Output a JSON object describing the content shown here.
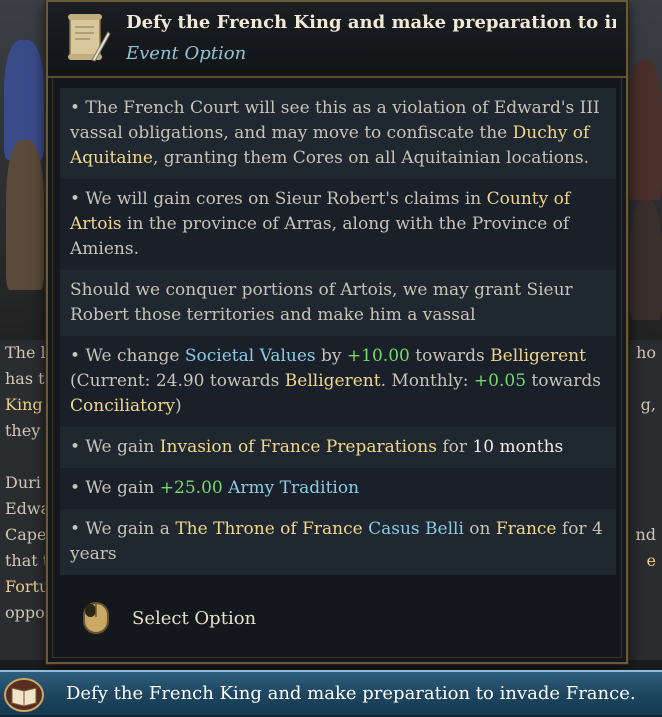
{
  "tooltip": {
    "title": "Defy the French King and make preparation to invade F ...",
    "subtitle": "Event Option",
    "effects": [
      [
        {
          "t": "• The French Court will see this as a violation of Edward's III vassal obligations, and may move to confiscate the ",
          "c": ""
        },
        {
          "t": "Duchy of Aquitaine",
          "c": "hl-y"
        },
        {
          "t": ", granting them Cores on all Aquitainian locations.",
          "c": ""
        }
      ],
      [
        {
          "t": "• We will gain cores on Sieur Robert's claims in ",
          "c": ""
        },
        {
          "t": "County of Artois",
          "c": "hl-y"
        },
        {
          "t": " in the province of Arras, along with the Province of Amiens.",
          "c": ""
        }
      ],
      [
        {
          "t": "Should we conquer portions of Artois, we may grant Sieur Robert those territories and make him a vassal",
          "c": ""
        }
      ],
      [
        {
          "t": "• We change ",
          "c": ""
        },
        {
          "t": "Societal Values",
          "c": "hl-b"
        },
        {
          "t": " by ",
          "c": ""
        },
        {
          "t": "+10.00",
          "c": "hl-g"
        },
        {
          "t": " towards ",
          "c": ""
        },
        {
          "t": "Belligerent",
          "c": "hl-y"
        },
        {
          "t": " (Current: 24.90 towards ",
          "c": ""
        },
        {
          "t": "Belligerent",
          "c": "hl-y"
        },
        {
          "t": ". Monthly: ",
          "c": ""
        },
        {
          "t": "+0.05",
          "c": "hl-g"
        },
        {
          "t": " towards ",
          "c": ""
        },
        {
          "t": "Conciliatory",
          "c": "hl-y"
        },
        {
          "t": ")",
          "c": ""
        }
      ],
      [
        {
          "t": "• We gain ",
          "c": ""
        },
        {
          "t": "Invasion of France Preparations",
          "c": "hl-y"
        },
        {
          "t": " for ",
          "c": ""
        },
        {
          "t": "10 months",
          "c": "hl-w"
        }
      ],
      [
        {
          "t": "• We gain ",
          "c": ""
        },
        {
          "t": "+25.00",
          "c": "hl-g"
        },
        {
          "t": " ",
          "c": ""
        },
        {
          "t": "Army Tradition",
          "c": "hl-b"
        }
      ],
      [
        {
          "t": "• We gain a ",
          "c": ""
        },
        {
          "t": "The Throne of France",
          "c": "hl-y"
        },
        {
          "t": " ",
          "c": ""
        },
        {
          "t": "Casus Belli",
          "c": "hl-b"
        },
        {
          "t": " on ",
          "c": ""
        },
        {
          "t": "France",
          "c": "hl-y"
        },
        {
          "t": " for 4 years",
          "c": ""
        }
      ]
    ],
    "select_label": "Select Option"
  },
  "background": {
    "left_fragments": [
      "The l",
      "has t",
      "King",
      "they",
      "",
      "Duri",
      "Edwa",
      "Cape",
      "that t",
      "Fortu",
      "oppo"
    ],
    "right_fragments": [
      "ho",
      "",
      "g,",
      "",
      "",
      "",
      "",
      "nd",
      "e",
      "",
      ""
    ]
  },
  "option_button": {
    "label": "Defy the French King and make preparation to invade France."
  },
  "colors": {
    "gold_text": "#f2d78a",
    "blue_text": "#8ccbe3",
    "green_text": "#79d86a",
    "panel_bg": "#14171b",
    "border": "#6b5a3a",
    "button_blue": "#1e4660"
  },
  "icons": {
    "header": "scroll-quill-icon",
    "select": "mouse-icon",
    "option": "book-icon"
  }
}
